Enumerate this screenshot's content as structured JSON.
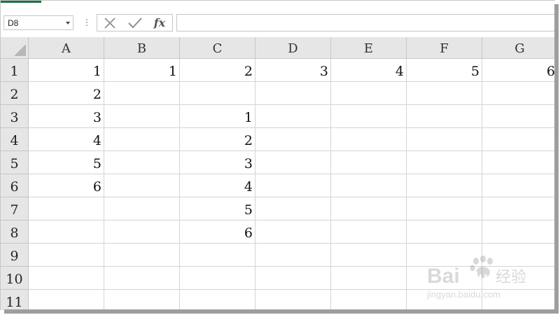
{
  "formula_bar": {
    "name_box": "D8",
    "more_glyph": "⋮",
    "fx_glyph": "fx",
    "formula_value": ""
  },
  "columns": [
    "A",
    "B",
    "C",
    "D",
    "E",
    "F",
    "G"
  ],
  "rows": [
    "1",
    "2",
    "3",
    "4",
    "5",
    "6",
    "7",
    "8",
    "9",
    "10",
    "11"
  ],
  "cells": [
    [
      "1",
      "1",
      "2",
      "3",
      "4",
      "5",
      "6"
    ],
    [
      "2",
      "",
      "",
      "",
      "",
      "",
      ""
    ],
    [
      "3",
      "",
      "1",
      "",
      "",
      "",
      ""
    ],
    [
      "4",
      "",
      "2",
      "",
      "",
      "",
      ""
    ],
    [
      "5",
      "",
      "3",
      "",
      "",
      "",
      ""
    ],
    [
      "6",
      "",
      "4",
      "",
      "",
      "",
      ""
    ],
    [
      "",
      "",
      "5",
      "",
      "",
      "",
      ""
    ],
    [
      "",
      "",
      "6",
      "",
      "",
      "",
      ""
    ],
    [
      "",
      "",
      "",
      "",
      "",
      "",
      ""
    ],
    [
      "",
      "",
      "",
      "",
      "",
      "",
      ""
    ],
    [
      "",
      "",
      "",
      "",
      "",
      "",
      ""
    ]
  ],
  "watermark": {
    "logo_text": "Bai",
    "logo_text2": "du",
    "site_cn": "经验",
    "url": "jingyan.baidu.com"
  },
  "colors": {
    "header_bg": "#e6e6e6",
    "grid_line": "#d4d4d4",
    "accent_green": "#1e7145"
  }
}
